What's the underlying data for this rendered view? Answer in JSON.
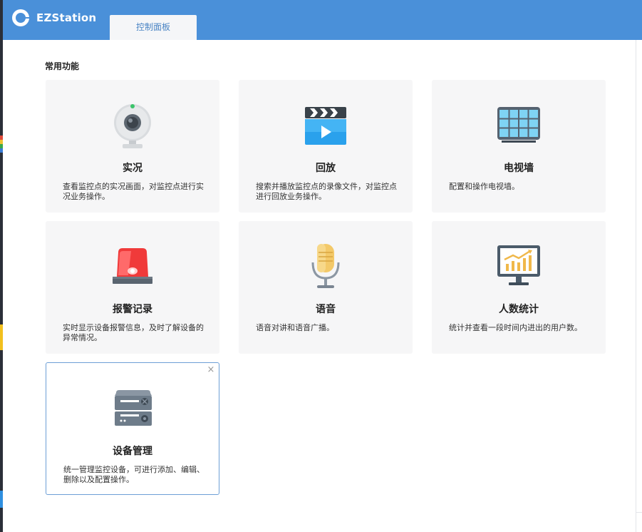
{
  "app": {
    "title": "EZStation",
    "logo_icon": "ezstation-logo-icon"
  },
  "tabs": [
    {
      "label": "控制面板"
    }
  ],
  "section": {
    "title": "常用功能"
  },
  "cards": [
    {
      "title": "实况",
      "desc": "查看监控点的实况画面，对监控点进行实况业务操作。",
      "icon": "webcam-icon"
    },
    {
      "title": "回放",
      "desc": "搜索并播放监控点的录像文件，对监控点进行回放业务操作。",
      "icon": "video-playback-icon"
    },
    {
      "title": "电视墙",
      "desc": "配置和操作电视墙。",
      "icon": "video-wall-icon"
    },
    {
      "title": "报警记录",
      "desc": "实时显示设备报警信息，及时了解设备的异常情况。",
      "icon": "alarm-light-icon"
    },
    {
      "title": "语音",
      "desc": "语音对讲和语音广播。",
      "icon": "microphone-icon"
    },
    {
      "title": "人数统计",
      "desc": "统计并查看一段时间内进出的用户数。",
      "icon": "statistics-monitor-icon"
    },
    {
      "title": "设备管理",
      "desc": "统一管理监控设备，可进行添加、编辑、删除以及配置操作。",
      "icon": "device-server-icon",
      "close": "×"
    }
  ],
  "colors": {
    "accent": "#4a90d9",
    "card_bg": "#f6f6f7",
    "selected_border": "#6d9fd6"
  }
}
